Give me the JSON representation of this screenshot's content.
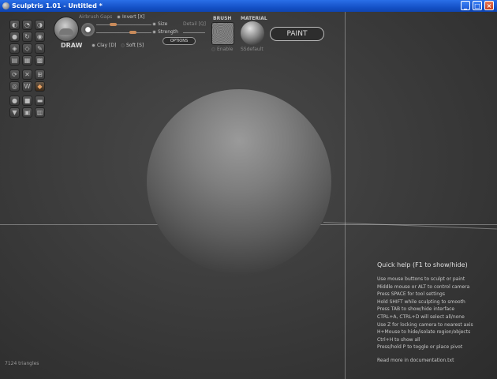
{
  "window": {
    "title": "Sculptris 1.01 - Untitled *",
    "minimize": "_",
    "maximize": "□",
    "close": "×"
  },
  "tools": {
    "selected_label": "DRAW",
    "active_icon": "draw-tool-icon",
    "icons": [
      "draw-icon",
      "flatten-icon",
      "grab-icon",
      "inflate-icon",
      "rotate-icon",
      "scale-icon",
      "crease-icon",
      "pinch-icon",
      "pinch-icon",
      "smooth-icon",
      "move-icon",
      "brush-icon",
      "reduce-icon",
      "mask-icon",
      "subdivide-icon",
      "wireframe-icon",
      "symmetry-icon",
      "brush-icon",
      "mirror-icon",
      "ring-icon",
      "paint-icon",
      "layer-icon",
      "sphere-icon",
      "cube-icon",
      "plane-icon",
      "grid-icon",
      "save-icon",
      "open-icon"
    ]
  },
  "options": {
    "airbrush": "Airbrush",
    "gaps": "Gaps",
    "invert": "Invert [X]",
    "size": "Size",
    "strength": "Strength",
    "detail": "Detail [Q]",
    "options_button": "OPTIONS",
    "clay": "Clay [D]",
    "soft": "Soft [S]"
  },
  "brush": {
    "label": "BRUSH",
    "enable": "Enable"
  },
  "material": {
    "label": "MATERIAL",
    "name": "SSdefault"
  },
  "paint_button": "PAINT",
  "help": {
    "title": "Quick help (F1 to show/hide)",
    "lines": [
      "Use mouse buttons to sculpt or paint",
      "Middle mouse or ALT to control camera",
      "Press SPACE for tool settings",
      "Hold SHIFT while sculpting to smooth",
      "Press TAB to show/hide interface",
      "CTRL+A, CTRL+D will select all/none",
      "Use Z for locking camera to nearest axis",
      "H+Mouse to hide/isolate region/objects",
      "Ctrl+H to show all",
      "Press/hold P to toggle or place pivot"
    ],
    "more": "Read more in documentation.txt"
  },
  "status": {
    "triangles": "7124 triangles"
  },
  "colors": {
    "titlebar": "#1552c8",
    "accent": "#c88a5a",
    "background": "#3a3a3a"
  }
}
